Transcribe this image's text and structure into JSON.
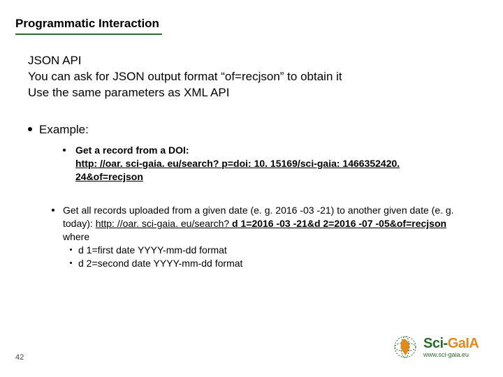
{
  "title": "Programmatic Interaction",
  "intro": {
    "line1": "JSON API",
    "line2": "You can ask for JSON output format “of=recjson” to obtain it",
    "line3": "Use the same parameters as XML API"
  },
  "example_label": "Example:",
  "ex1": {
    "lead": "Get a record from a DOI:",
    "url_text": "http: //oar. sci-gaia. eu/search? ",
    "url_bold": "p=doi: 10. 15169/sci-gaia: 1466352420. 24&of=recjson"
  },
  "ex2": {
    "lead_a": "Get all records uploaded from a given date (e. g. 2016 -03 -21) to another given date (e. g. today): ",
    "url_text": "http: //oar. sci-gaia. eu/search? ",
    "url_bold": "d 1=2016 -03 -21&d 2=2016 -07 -05&of=recjson",
    "where": "where",
    "d1": "d 1=first date YYYY-mm-dd format",
    "d2": "d 2=second date YYYY-mm-dd format"
  },
  "pagenum": "42",
  "logo": {
    "brand_sci": "Sci-",
    "brand_gaia": "GaIA",
    "url": "www.sci-gaia.eu"
  }
}
